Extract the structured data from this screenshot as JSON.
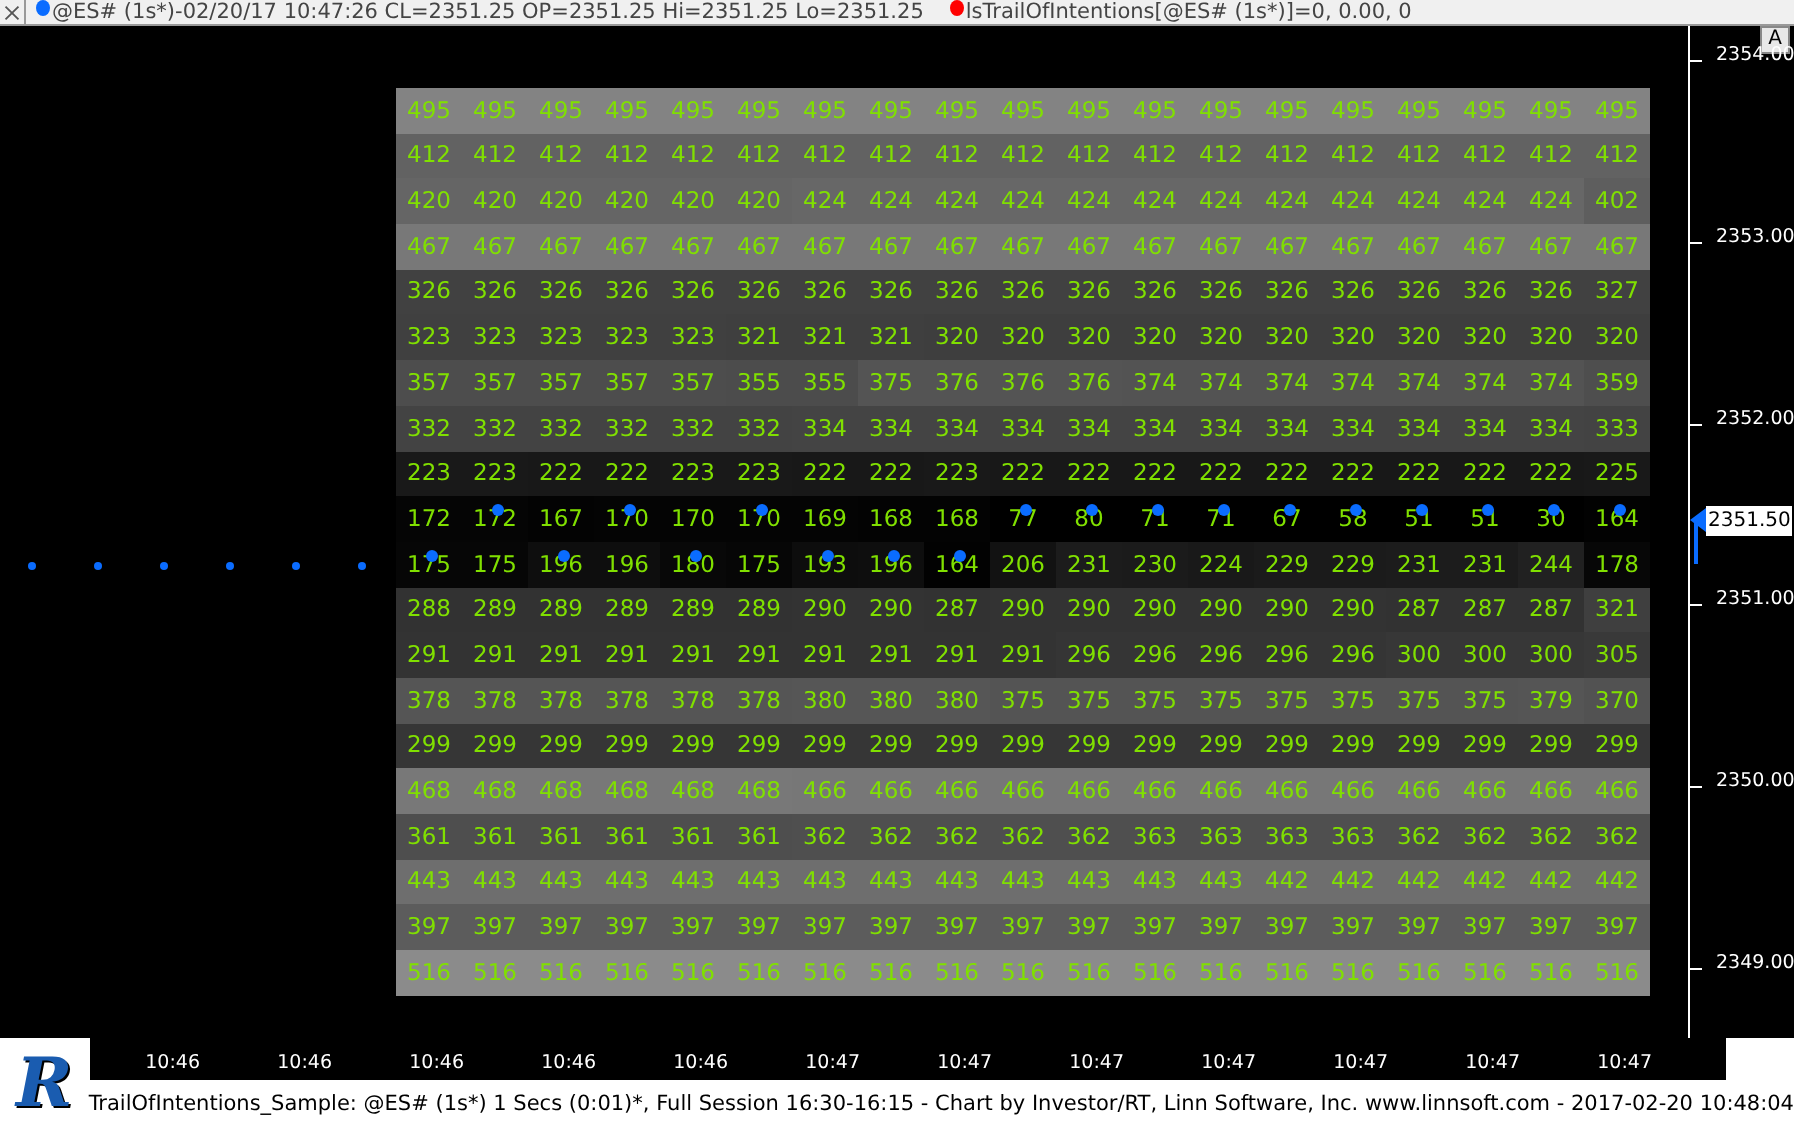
{
  "header": {
    "legend": [
      {
        "text": "@ES# (1s*)-02/20/17 10:47:26 CL=2351.25 OP=2351.25 Hi=2351.25 Lo=2351.25",
        "color": "#0a6cff"
      },
      {
        "text": "lsTrailOfIntentions[@ES# (1s*)]=0, 0.00, 0",
        "color": "#ff0000"
      }
    ]
  },
  "axis_button": "A",
  "grid": {
    "rows": [
      {
        "values": [
          "495",
          "495",
          "495",
          "495",
          "495",
          "495",
          "495",
          "495",
          "495",
          "495",
          "495",
          "495",
          "495",
          "495",
          "495",
          "495",
          "495",
          "495",
          "495"
        ]
      },
      {
        "values": [
          "412",
          "412",
          "412",
          "412",
          "412",
          "412",
          "412",
          "412",
          "412",
          "412",
          "412",
          "412",
          "412",
          "412",
          "412",
          "412",
          "412",
          "412",
          "412"
        ]
      },
      {
        "values": [
          "420",
          "420",
          "420",
          "420",
          "420",
          "420",
          "424",
          "424",
          "424",
          "424",
          "424",
          "424",
          "424",
          "424",
          "424",
          "424",
          "424",
          "424",
          "402"
        ]
      },
      {
        "values": [
          "467",
          "467",
          "467",
          "467",
          "467",
          "467",
          "467",
          "467",
          "467",
          "467",
          "467",
          "467",
          "467",
          "467",
          "467",
          "467",
          "467",
          "467",
          "467"
        ]
      },
      {
        "values": [
          "326",
          "326",
          "326",
          "326",
          "326",
          "326",
          "326",
          "326",
          "326",
          "326",
          "326",
          "326",
          "326",
          "326",
          "326",
          "326",
          "326",
          "326",
          "327"
        ]
      },
      {
        "values": [
          "323",
          "323",
          "323",
          "323",
          "323",
          "321",
          "321",
          "321",
          "320",
          "320",
          "320",
          "320",
          "320",
          "320",
          "320",
          "320",
          "320",
          "320",
          "320"
        ]
      },
      {
        "values": [
          "357",
          "357",
          "357",
          "357",
          "357",
          "355",
          "355",
          "375",
          "376",
          "376",
          "376",
          "374",
          "374",
          "374",
          "374",
          "374",
          "374",
          "374",
          "359"
        ]
      },
      {
        "values": [
          "332",
          "332",
          "332",
          "332",
          "332",
          "332",
          "334",
          "334",
          "334",
          "334",
          "334",
          "334",
          "334",
          "334",
          "334",
          "334",
          "334",
          "334",
          "333"
        ]
      },
      {
        "values": [
          "223",
          "223",
          "222",
          "222",
          "223",
          "223",
          "222",
          "222",
          "223",
          "222",
          "222",
          "222",
          "222",
          "222",
          "222",
          "222",
          "222",
          "222",
          "225"
        ]
      },
      {
        "values": [
          "172",
          "172",
          "167",
          "170",
          "170",
          "170",
          "169",
          "168",
          "168",
          "77",
          "80",
          "71",
          "71",
          "67",
          "58",
          "51",
          "51",
          "30",
          "164"
        ],
        "dots": [
          false,
          true,
          false,
          true,
          false,
          true,
          false,
          false,
          false,
          true,
          true,
          true,
          true,
          true,
          true,
          true,
          true,
          true,
          true
        ]
      },
      {
        "values": [
          "175",
          "175",
          "196",
          "196",
          "180",
          "175",
          "193",
          "196",
          "164",
          "206",
          "231",
          "230",
          "224",
          "229",
          "229",
          "231",
          "231",
          "244",
          "178"
        ],
        "dots": [
          true,
          false,
          true,
          false,
          true,
          false,
          true,
          true,
          true,
          false,
          false,
          false,
          false,
          false,
          false,
          false,
          false,
          false,
          false
        ]
      },
      {
        "values": [
          "288",
          "289",
          "289",
          "289",
          "289",
          "289",
          "290",
          "290",
          "287",
          "290",
          "290",
          "290",
          "290",
          "290",
          "290",
          "287",
          "287",
          "287",
          "321"
        ]
      },
      {
        "values": [
          "291",
          "291",
          "291",
          "291",
          "291",
          "291",
          "291",
          "291",
          "291",
          "291",
          "296",
          "296",
          "296",
          "296",
          "296",
          "300",
          "300",
          "300",
          "305"
        ]
      },
      {
        "values": [
          "378",
          "378",
          "378",
          "378",
          "378",
          "378",
          "380",
          "380",
          "380",
          "375",
          "375",
          "375",
          "375",
          "375",
          "375",
          "375",
          "375",
          "379",
          "370"
        ]
      },
      {
        "values": [
          "299",
          "299",
          "299",
          "299",
          "299",
          "299",
          "299",
          "299",
          "299",
          "299",
          "299",
          "299",
          "299",
          "299",
          "299",
          "299",
          "299",
          "299",
          "299"
        ]
      },
      {
        "values": [
          "468",
          "468",
          "468",
          "468",
          "468",
          "468",
          "466",
          "466",
          "466",
          "466",
          "466",
          "466",
          "466",
          "466",
          "466",
          "466",
          "466",
          "466",
          "466"
        ]
      },
      {
        "values": [
          "361",
          "361",
          "361",
          "361",
          "361",
          "361",
          "362",
          "362",
          "362",
          "362",
          "362",
          "363",
          "363",
          "363",
          "363",
          "362",
          "362",
          "362",
          "362"
        ]
      },
      {
        "values": [
          "443",
          "443",
          "443",
          "443",
          "443",
          "443",
          "443",
          "443",
          "443",
          "443",
          "443",
          "443",
          "443",
          "442",
          "442",
          "442",
          "442",
          "442",
          "442"
        ]
      },
      {
        "values": [
          "397",
          "397",
          "397",
          "397",
          "397",
          "397",
          "397",
          "397",
          "397",
          "397",
          "397",
          "397",
          "397",
          "397",
          "397",
          "397",
          "397",
          "397",
          "397"
        ]
      },
      {
        "values": [
          "516",
          "516",
          "516",
          "516",
          "516",
          "516",
          "516",
          "516",
          "516",
          "516",
          "516",
          "516",
          "516",
          "516",
          "516",
          "516",
          "516",
          "516",
          "516"
        ]
      }
    ]
  },
  "price_axis": {
    "labels": [
      "2354.00",
      "2353.00",
      "2352.00",
      "2351.00",
      "2350.00",
      "2349.00"
    ],
    "current": "2351.50"
  },
  "time_axis": [
    "10:46",
    "10:46",
    "10:46",
    "10:46",
    "10:46",
    "10:47",
    "10:47",
    "10:47",
    "10:47",
    "10:47",
    "10:47",
    "10:47"
  ],
  "logo": "R",
  "status": "TrailOfIntentions_Sample: @ES# (1s*) 1 Secs (0:01)*, Full Session 16:30-16:15 - Chart by Investor/RT, Linn Software, Inc. www.linnsoft.com - 2017-02-20 10:48:04"
}
